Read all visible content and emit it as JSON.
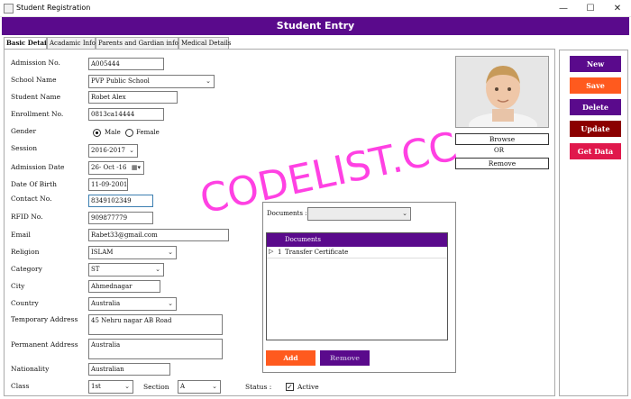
{
  "window": {
    "title": "Student Registration",
    "minimize": "—",
    "maximize": "☐",
    "close": "✕"
  },
  "header": {
    "title": "Student Entry"
  },
  "tabs": [
    {
      "label": "Basic Details"
    },
    {
      "label": "Acadamic Info"
    },
    {
      "label": "Parents and Gardian info"
    },
    {
      "label": "Medical Details"
    }
  ],
  "form": {
    "admission_no": {
      "label": "Admission No.",
      "value": "A005444"
    },
    "school_name": {
      "label": "School Name",
      "value": "PVP  Public School"
    },
    "student_name": {
      "label": "Student Name",
      "value": "Robet Alex"
    },
    "enrollment_no": {
      "label": "Enrollment No.",
      "value": "0813ca14444"
    },
    "gender": {
      "label": "Gender",
      "male": "Male",
      "female": "Female",
      "selected": "Male"
    },
    "session": {
      "label": "Session",
      "value": "2016-2017"
    },
    "admission_date": {
      "label": "Admission Date",
      "value": "26- Oct -16"
    },
    "dob": {
      "label": "Date Of Birth",
      "value": "11-09-2001"
    },
    "contact_no": {
      "label": "Contact No.",
      "value": "8349102349"
    },
    "rfid_no": {
      "label": "RFID No.",
      "value": "909877779"
    },
    "email": {
      "label": "Email",
      "value": "Rabet33@gmail.com"
    },
    "religion": {
      "label": "Religion",
      "value": "ISLAM"
    },
    "category": {
      "label": "Category",
      "value": "ST"
    },
    "city": {
      "label": "City",
      "value": "Ahmednagar"
    },
    "country": {
      "label": "Country",
      "value": "Australia"
    },
    "temporary_address": {
      "label": "Temporary Address",
      "value": "45 Nehru nagar AB Road"
    },
    "permanent_address": {
      "label": "Permanent Address",
      "value": "Australia"
    },
    "nationality": {
      "label": "Nationality",
      "value": "Australian"
    },
    "class": {
      "label": "Class",
      "value": "1st"
    },
    "section": {
      "label": "Section",
      "value": "A"
    },
    "status": {
      "label": "Status :",
      "checkbox_label": "Active",
      "checked": true
    }
  },
  "photo": {
    "browse": "Browse",
    "or": "OR",
    "remove": "Remove"
  },
  "documents": {
    "label": "Documents :",
    "column": "Documents",
    "rows": [
      {
        "no": "1",
        "name": "Transfer Certificate"
      }
    ],
    "add": "Add",
    "remove": "Remove"
  },
  "actions": {
    "new": "New",
    "save": "Save",
    "delete": "Delete",
    "update": "Update",
    "get_data": "Get Data"
  },
  "watermark": "CODELIST.CC",
  "colors": {
    "header": "#5a0a8c",
    "save": "#ff5a1e",
    "delete": "#5a0a8c",
    "update": "#8b0000",
    "get_data": "#e0184c",
    "watermark": "#ff2de0"
  }
}
